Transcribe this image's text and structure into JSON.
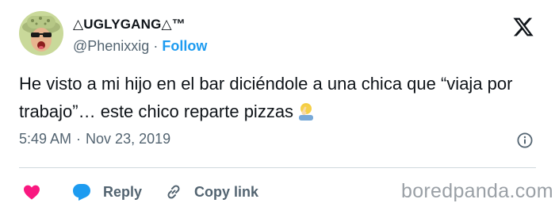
{
  "author": {
    "display_name": "△UGLYGANG△™",
    "handle": "@Phenixxig",
    "separator": "·",
    "follow_label": "Follow"
  },
  "tweet": {
    "text": "He visto a mi hijo en el bar diciéndole a una chica que “viaja por trabajo”… este chico reparte pizzas",
    "emoji": "person-facepalming"
  },
  "meta": {
    "time": "5:49 AM",
    "separator": "·",
    "date": "Nov 23, 2019"
  },
  "actions": {
    "reply_label": "Reply",
    "copy_link_label": "Copy link"
  },
  "watermark": "boredpanda.com",
  "colors": {
    "accent": "#1d9bf0",
    "heart": "#f91880",
    "reply_icon": "#1d9bf0",
    "secondary_text": "#536471",
    "primary_text": "#0f1419"
  },
  "icons": [
    "x-logo-icon",
    "info-icon",
    "heart-icon",
    "reply-bubble-icon",
    "link-icon",
    "facepalm-emoji-icon"
  ]
}
